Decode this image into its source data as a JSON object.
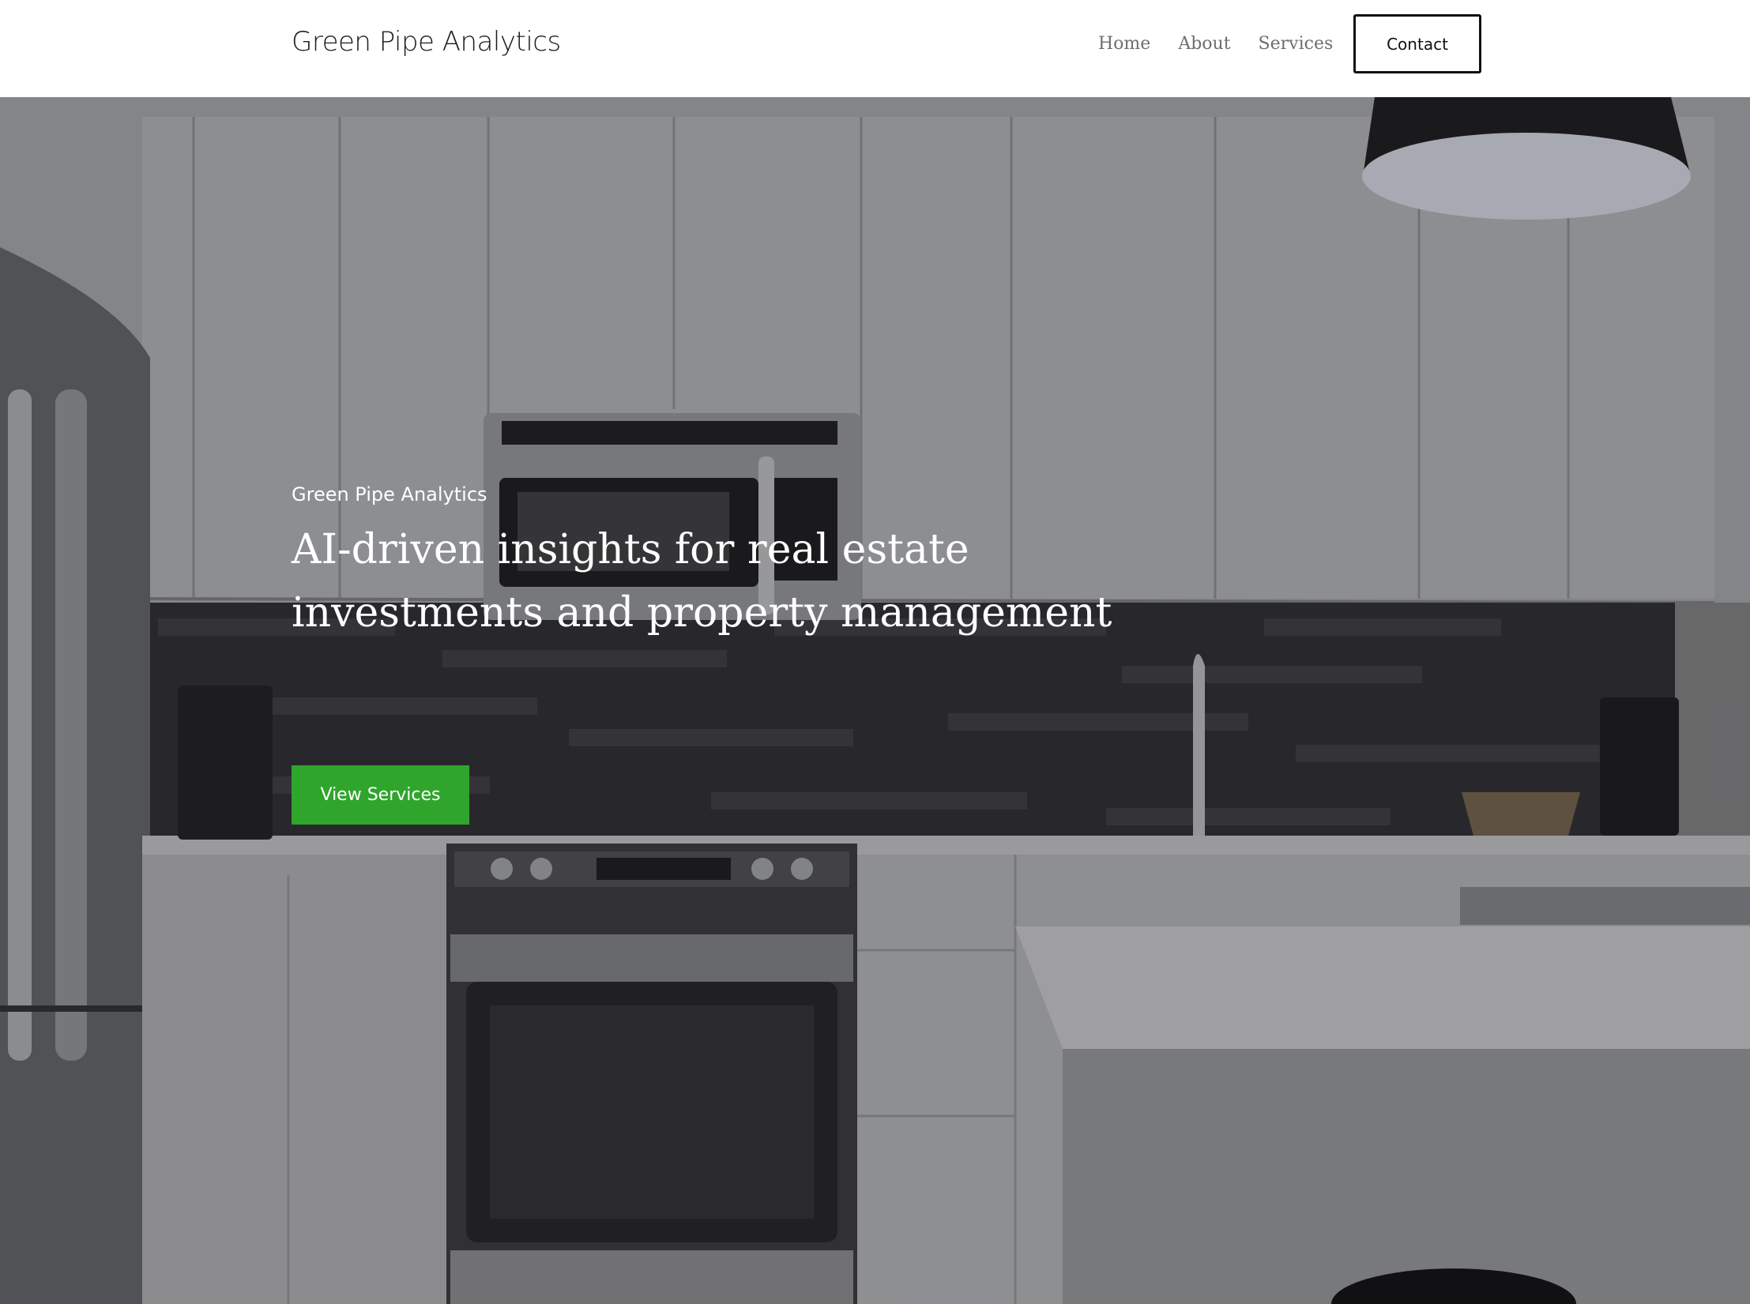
{
  "header": {
    "brand": "Green Pipe Analytics",
    "nav": {
      "home": "Home",
      "about": "About",
      "services": "Services",
      "contact": "Contact"
    }
  },
  "hero": {
    "eyebrow": "Green Pipe Analytics",
    "title": "AI-driven insights for real estate investments and property management",
    "cta": "View Services",
    "background_image": "kitchen-photo",
    "accent_color": "#2fa52c"
  }
}
